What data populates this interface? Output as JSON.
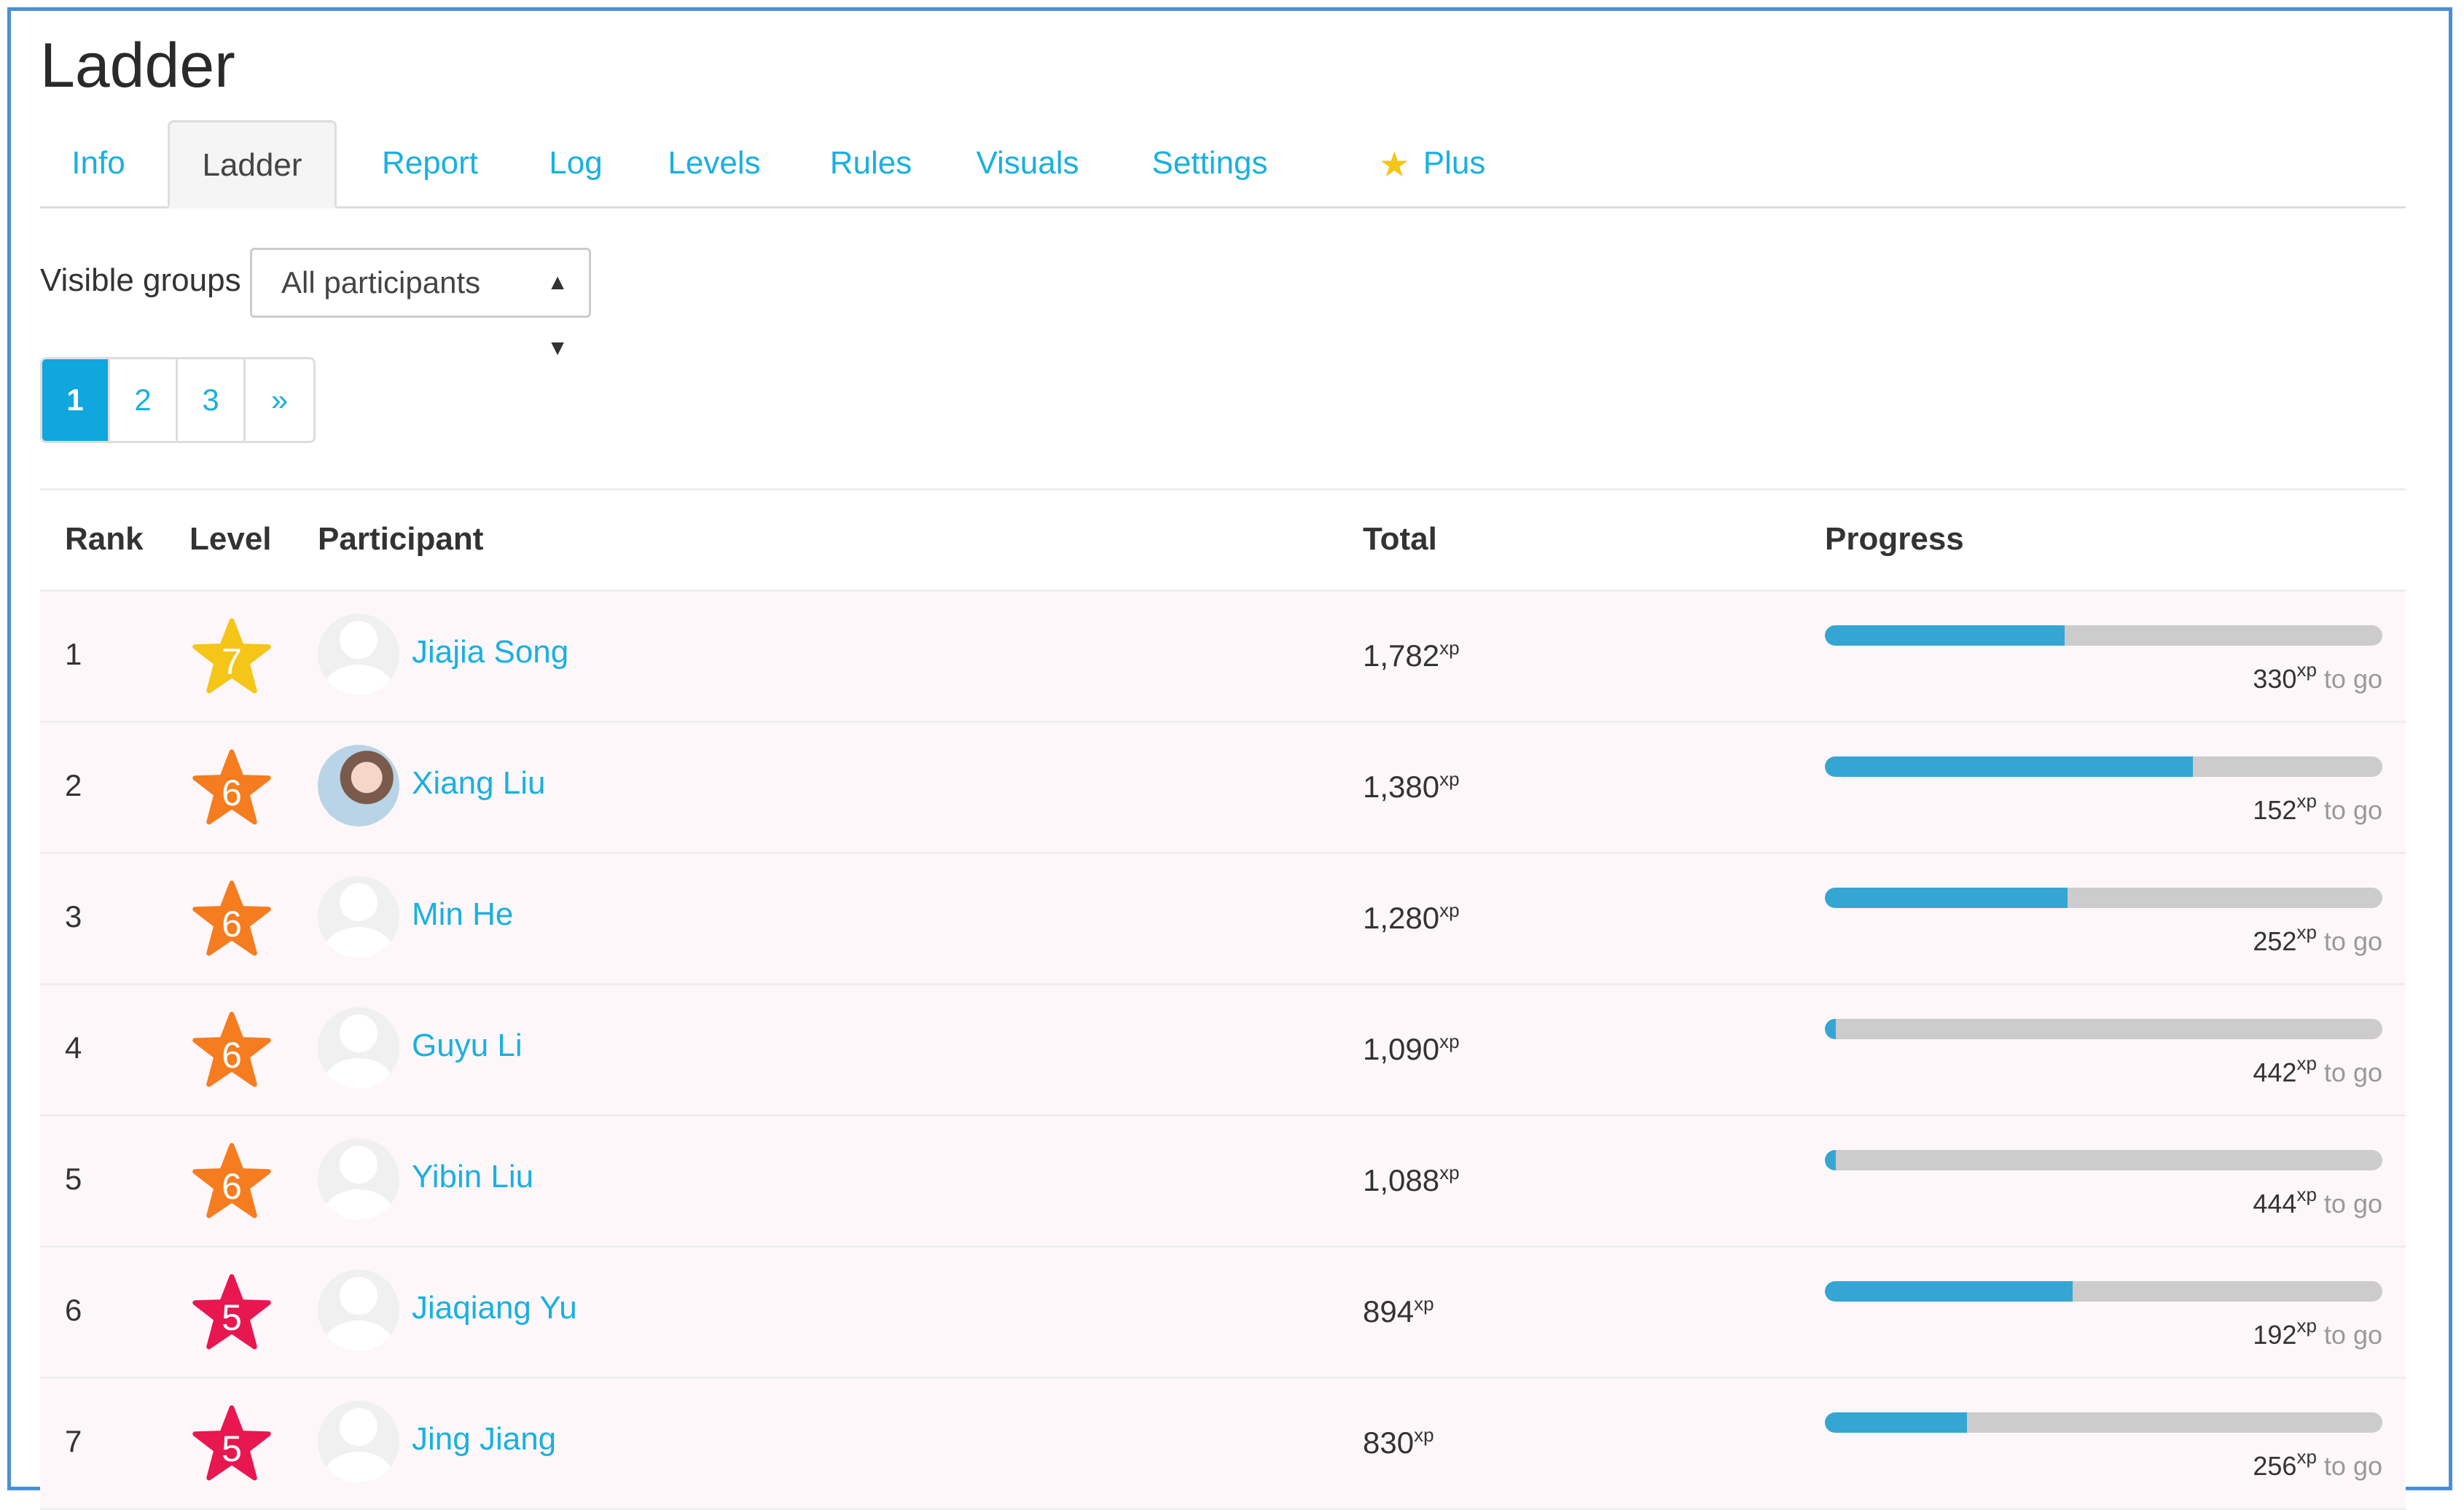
{
  "page": {
    "title": "Ladder"
  },
  "tabs": [
    {
      "label": "Info",
      "active": false
    },
    {
      "label": "Ladder",
      "active": true
    },
    {
      "label": "Report",
      "active": false
    },
    {
      "label": "Log",
      "active": false
    },
    {
      "label": "Levels",
      "active": false
    },
    {
      "label": "Rules",
      "active": false
    },
    {
      "label": "Visuals",
      "active": false
    },
    {
      "label": "Settings",
      "active": false
    },
    {
      "label": "Plus",
      "active": false,
      "icon": "star-icon"
    }
  ],
  "groups": {
    "label": "Visible groups",
    "selected": "All participants"
  },
  "pagination": {
    "pages": [
      "1",
      "2",
      "3"
    ],
    "next": "»",
    "current": "1"
  },
  "table": {
    "headers": {
      "rank": "Rank",
      "level": "Level",
      "participant": "Participant",
      "total": "Total",
      "progress": "Progress"
    },
    "xp_unit": "xp",
    "togo_label": "to go",
    "rows": [
      {
        "rank": "1",
        "level": "7",
        "level_color": "#f5c518",
        "name": "Jiajia Song",
        "avatar": "default-avatar",
        "total": "1,782",
        "progress": 0.43,
        "togo": "330"
      },
      {
        "rank": "2",
        "level": "6",
        "level_color": "#f57c1f",
        "name": "Xiang Liu",
        "avatar": "photo-avatar",
        "total": "1,380",
        "progress": 0.66,
        "togo": "152"
      },
      {
        "rank": "3",
        "level": "6",
        "level_color": "#f57c1f",
        "name": "Min He",
        "avatar": "default-avatar",
        "total": "1,280",
        "progress": 0.435,
        "togo": "252"
      },
      {
        "rank": "4",
        "level": "6",
        "level_color": "#f57c1f",
        "name": "Guyu Li",
        "avatar": "default-avatar",
        "total": "1,090",
        "progress": 0.02,
        "togo": "442"
      },
      {
        "rank": "5",
        "level": "6",
        "level_color": "#f57c1f",
        "name": "Yibin Liu",
        "avatar": "default-avatar",
        "total": "1,088",
        "progress": 0.02,
        "togo": "444"
      },
      {
        "rank": "6",
        "level": "5",
        "level_color": "#e8174f",
        "name": "Jiaqiang Yu",
        "avatar": "default-avatar",
        "total": "894",
        "progress": 0.445,
        "togo": "192"
      },
      {
        "rank": "7",
        "level": "5",
        "level_color": "#e8174f",
        "name": "Jing Jiang",
        "avatar": "default-avatar",
        "total": "830",
        "progress": 0.255,
        "togo": "256"
      }
    ]
  },
  "colors": {
    "accent": "#1ab0e0",
    "progress_fill": "#35a6d4",
    "progress_track": "#cccccc",
    "frame_border": "#4a8fd9"
  }
}
